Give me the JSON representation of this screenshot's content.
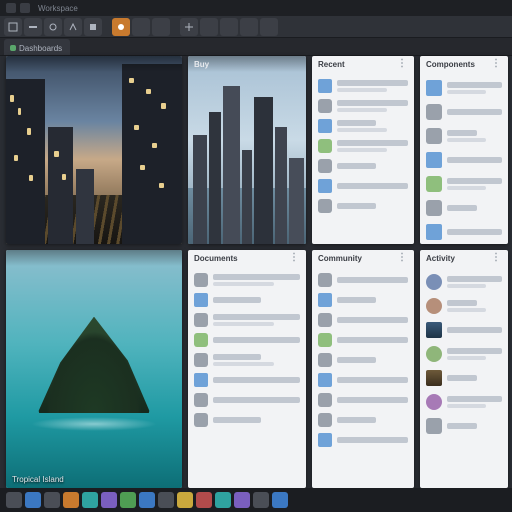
{
  "titlebar": {
    "active_app": "Workspace"
  },
  "tabs": [
    {
      "label": "Dashboards"
    }
  ],
  "panels": {
    "city_left": {
      "title": ""
    },
    "skyline_mid": {
      "title": "Buy"
    },
    "island": {
      "title": "",
      "caption": "Tropical Island"
    },
    "list_small": {
      "title": "Recent",
      "items": [
        "",
        "",
        "",
        "",
        "",
        "",
        ""
      ]
    },
    "list_tall_top": {
      "title": "Components",
      "items": [
        "",
        "",
        "",
        "",
        "",
        "",
        "",
        "",
        ""
      ]
    },
    "list_tall_bottom": {
      "title": "Community",
      "items": [
        "",
        "",
        "",
        "",
        "",
        "",
        "",
        "",
        "",
        ""
      ]
    },
    "activity": {
      "title": "Activity",
      "items": [
        "",
        "",
        "",
        "",
        "",
        "",
        ""
      ]
    },
    "mid_split": {
      "title": "Documents",
      "items": [
        "",
        "",
        "",
        "",
        "",
        "",
        "",
        ""
      ]
    }
  },
  "taskbar": {
    "start": "Start",
    "apps": [
      "blue",
      "grey",
      "orange",
      "teal",
      "purple",
      "green",
      "blue",
      "grey",
      "yellow",
      "red",
      "teal",
      "purple",
      "grey",
      "blue"
    ]
  }
}
